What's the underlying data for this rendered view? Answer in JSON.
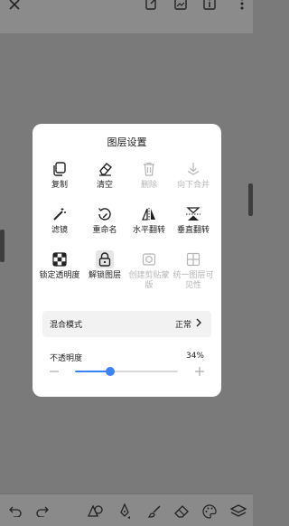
{
  "colors": {
    "accent": "#3b82f6",
    "disabled": "#b5b5b5"
  },
  "top": {
    "icons": [
      "close-icon",
      "edit-icon",
      "image-icon",
      "info-icon",
      "more-icon"
    ]
  },
  "dialog": {
    "title": "图层设置",
    "tools": [
      {
        "label": "复制",
        "icon": "copy-icon",
        "enabled": true
      },
      {
        "label": "清空",
        "icon": "eraser-icon",
        "enabled": true
      },
      {
        "label": "删除",
        "icon": "trash-icon",
        "enabled": false
      },
      {
        "label": "向下合并",
        "icon": "merge-down-icon",
        "enabled": false
      },
      {
        "label": "滤镜",
        "icon": "magic-wand-icon",
        "enabled": true
      },
      {
        "label": "重命名",
        "icon": "rename-icon",
        "enabled": true
      },
      {
        "label": "水平翻转",
        "icon": "flip-horizontal-icon",
        "enabled": true
      },
      {
        "label": "垂直翻转",
        "icon": "flip-vertical-icon",
        "enabled": true
      },
      {
        "label": "锁定透明度",
        "icon": "checker-icon",
        "enabled": true
      },
      {
        "label": "解锁图层",
        "icon": "unlock-icon",
        "enabled": true
      },
      {
        "label": "创建剪贴蒙版",
        "icon": "clip-mask-icon",
        "enabled": false
      },
      {
        "label": "统一图层可见性",
        "icon": "layers-visibility-icon",
        "enabled": false
      }
    ],
    "blend_mode": {
      "label": "混合模式",
      "value": "正常"
    },
    "opacity": {
      "label": "不透明度",
      "value_text": "34%",
      "value": 0.34
    }
  },
  "bottom": {
    "icons": [
      "undo-icon",
      "redo-icon",
      "shapes-icon",
      "pen-icon",
      "brush-icon",
      "eraser-icon",
      "palette-icon",
      "layers-icon"
    ]
  }
}
